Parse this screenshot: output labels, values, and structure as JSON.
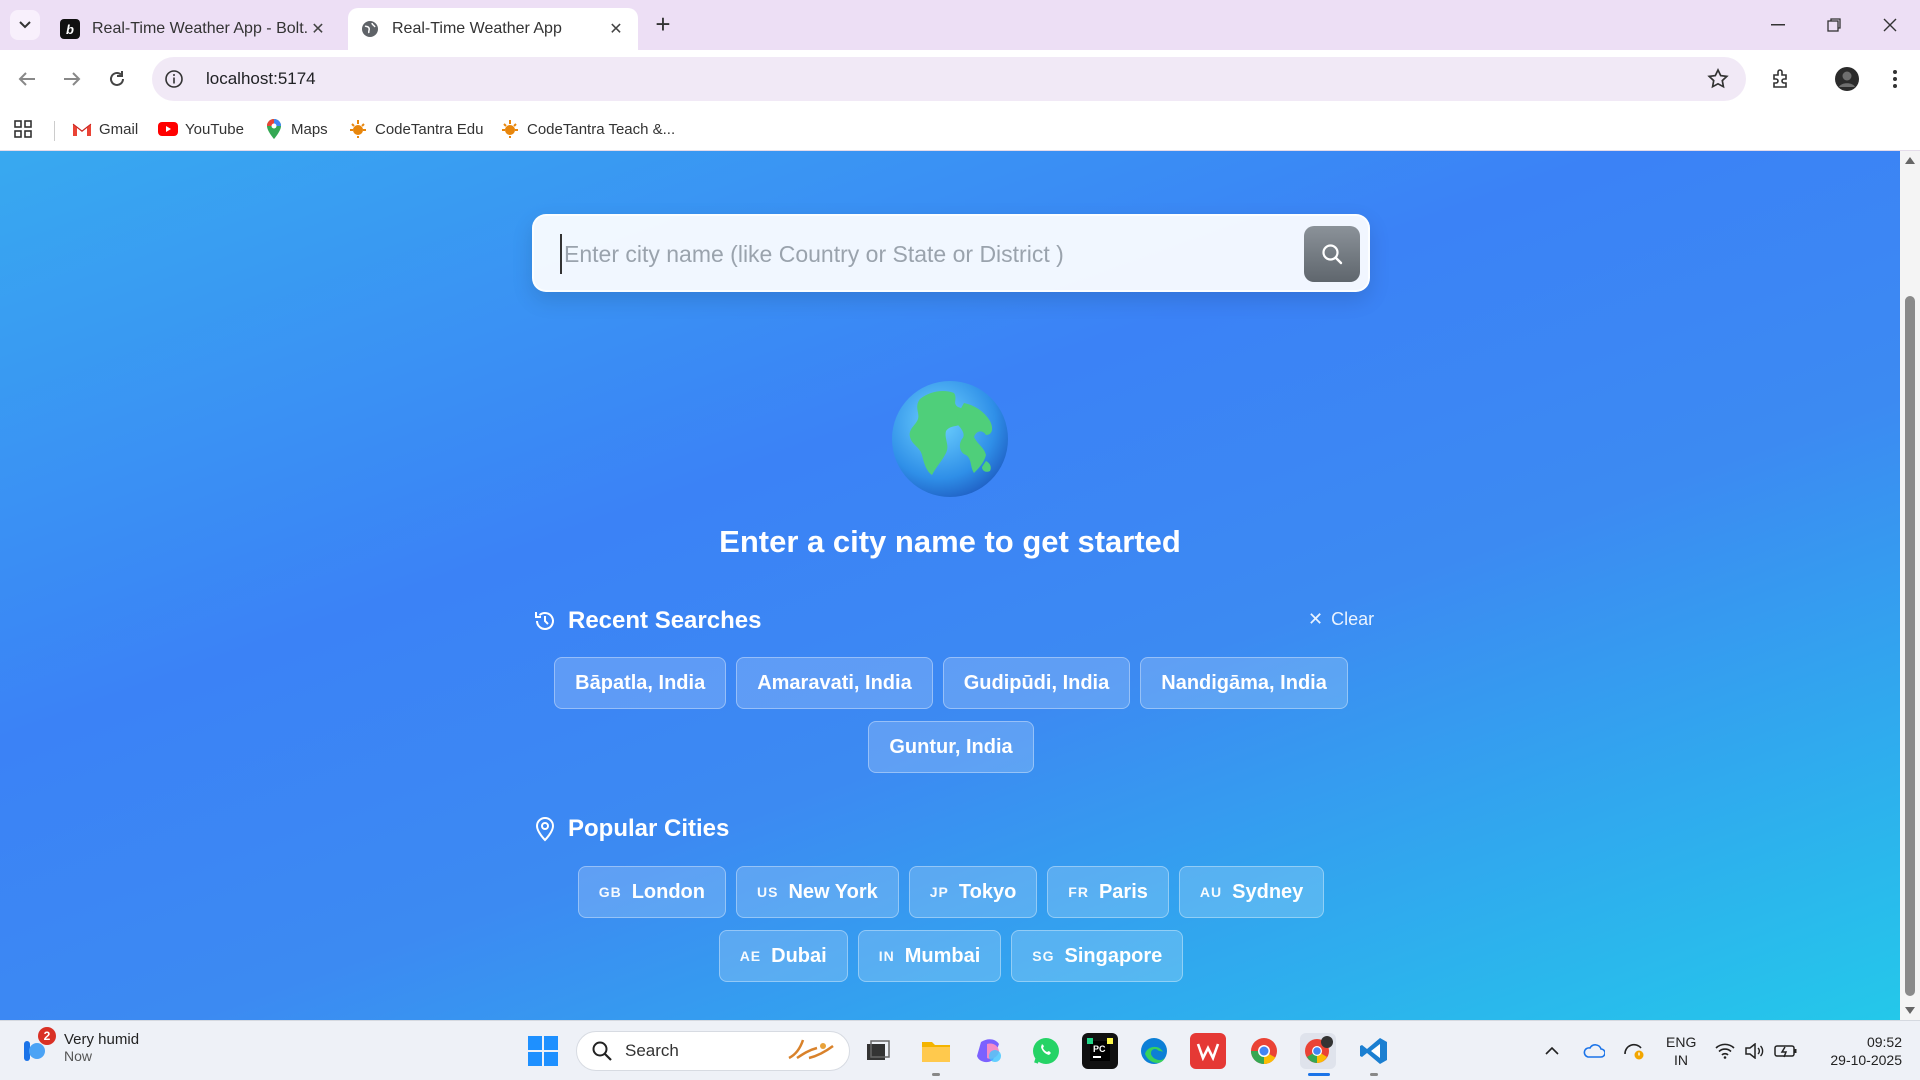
{
  "browser": {
    "tabs": [
      {
        "title": "Real-Time Weather App - Bolt.n",
        "active": false
      },
      {
        "title": "Real-Time Weather App",
        "active": true
      }
    ],
    "new_tab": "+",
    "address": "localhost:5174",
    "bookmarks": [
      {
        "label": "Gmail",
        "icon": "gmail-icon"
      },
      {
        "label": "YouTube",
        "icon": "youtube-icon"
      },
      {
        "label": "Maps",
        "icon": "maps-icon"
      },
      {
        "label": "CodeTantra Edu",
        "icon": "codetantra-icon"
      },
      {
        "label": "CodeTantra Teach &...",
        "icon": "codetantra-icon"
      }
    ]
  },
  "app": {
    "search_placeholder": "Enter city name (like Country or State or District )",
    "hero_text": "Enter a city name to get started",
    "recent": {
      "heading": "Recent Searches",
      "clear_label": "Clear",
      "items": [
        "Bāpatla, India",
        "Amaravati, India",
        "Gudipūdi, India",
        "Nandigāma, India",
        "Guntur, India"
      ]
    },
    "popular": {
      "heading": "Popular Cities",
      "items": [
        {
          "code": "GB",
          "name": "London"
        },
        {
          "code": "US",
          "name": "New York"
        },
        {
          "code": "JP",
          "name": "Tokyo"
        },
        {
          "code": "FR",
          "name": "Paris"
        },
        {
          "code": "AU",
          "name": "Sydney"
        },
        {
          "code": "AE",
          "name": "Dubai"
        },
        {
          "code": "IN",
          "name": "Mumbai"
        },
        {
          "code": "SG",
          "name": "Singapore"
        }
      ]
    }
  },
  "taskbar": {
    "weather_title": "Very humid",
    "weather_sub": "Now",
    "notification_count": "2",
    "search_label": "Search",
    "lang_line1": "ENG",
    "lang_line2": "IN",
    "time": "09:52",
    "date": "29-10-2025"
  },
  "colors": {
    "page_gradient_start": "#38a9f0",
    "page_gradient_mid": "#3b82f6",
    "page_gradient_end": "#24c8ea",
    "active_tab": "#ffffff",
    "tabstrip": "#eddff5"
  }
}
